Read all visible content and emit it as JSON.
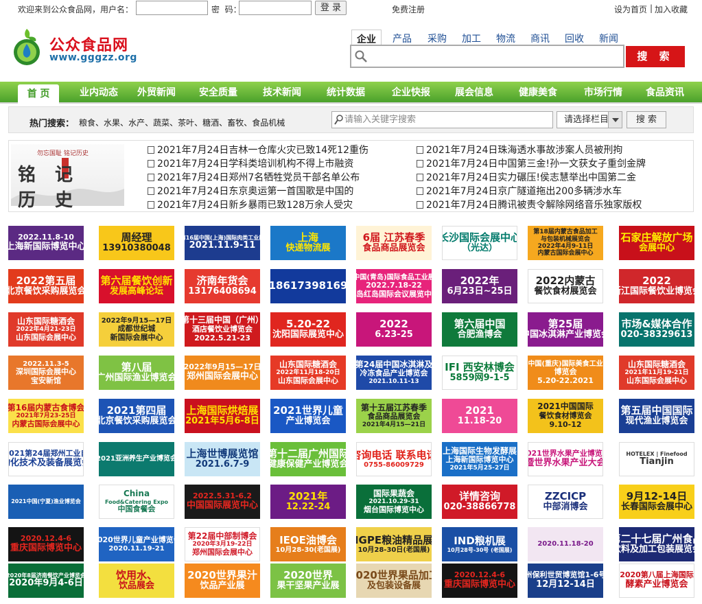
{
  "topbar": {
    "welcome": "欢迎来到公众食品网，用户名：",
    "password_label": "密  码：",
    "login": "登 录",
    "register": "免费注册",
    "set_home": "设为首页",
    "separator": "|",
    "favorite": "加入收藏"
  },
  "logo": {
    "name": "公众食品网",
    "url": "www.gggzz.org"
  },
  "search": {
    "tabs": [
      "企业",
      "产品",
      "采购",
      "加工",
      "物流",
      "商讯",
      "回收",
      "新闻"
    ],
    "active_tab": "企业",
    "button": "搜 索"
  },
  "nav": [
    "首 页",
    "业内动态",
    "外贸新闻",
    "安全质量",
    "技术新闻",
    "统计数据",
    "企业快报",
    "展会信息",
    "健康美食",
    "市场行情",
    "食品资讯"
  ],
  "hot": {
    "label": "热门搜索：",
    "words": [
      "粮食",
      "水果",
      "水产",
      "蔬菜",
      "茶叶",
      "糖酒",
      "畜牧",
      "食品机械"
    ],
    "placeholder": "请输入关键字搜索",
    "select": "请选择栏目",
    "button": "搜 索"
  },
  "news": {
    "image_text": "铭记历史",
    "image_small": "勿忘国耻 铭记历史",
    "left": [
      "2021年7月24日吉林一仓库火灾已致14死12重伤",
      "2021年7月24日学科类培训机构不得上市融资",
      "2021年7月24日郑州7名牺牲党员干部名单公布",
      "2021年7月24日东京奥运第一首国歌是中国的",
      "2021年7月24日新乡暴雨已致128万余人受灾"
    ],
    "right": [
      "2021年7月24日珠海透水事故涉案人员被刑拘",
      "2021年7月24日中国第三金!孙一文获女子重剑金牌",
      "2021年7月24日实力碾压!侯志慧举出中国第二金",
      "2021年7月24日京广隧道拖出200多辆涉水车",
      "2021年7月24日腾讯被责令解除网络音乐独家版权"
    ]
  },
  "ads": [
    [
      {
        "l": [
          "2022.11.8-10",
          "上海新国际博览中心"
        ],
        "bg": "#5b2a83",
        "fg": "#fff"
      },
      {
        "l": [
          "周经理",
          "13910380048"
        ],
        "bg": "#f8c71a",
        "fg": "#222"
      },
      {
        "l": [
          "第16届中国(上海)国际肉类工业展",
          "2021.11.9-11"
        ],
        "bg": "#1d3c8f",
        "fg": "#fff"
      },
      {
        "l": [
          "上海",
          "快递物流展"
        ],
        "bg": "#1b78c8",
        "fg": "#ffe600"
      },
      {
        "l": [
          "6届 江苏春季",
          "食品商品展览会"
        ],
        "bg": "#fff3d6",
        "fg": "#d0181d"
      },
      {
        "l": [
          "长沙国际会展中心",
          "（光达）"
        ],
        "bg": "#fff",
        "fg": "#007a6b"
      },
      {
        "l": [
          "第18届内蒙古食品加工",
          "与包装机械展览会",
          "2022年4月9-11日",
          "内蒙古国际会展中心"
        ],
        "bg": "#f6a81f",
        "fg": "#222"
      },
      {
        "l": [
          "石家庄解放广场",
          "会展中心"
        ],
        "bg": "#c8101a",
        "fg": "#ffee00"
      }
    ],
    [
      {
        "l": [
          "2022第五届",
          "北京餐饮采购展览会"
        ],
        "bg": "#e23b1c",
        "fg": "#fff"
      },
      {
        "l": [
          "第六届餐饮创新",
          "发展高峰论坛"
        ],
        "bg": "#d8102c",
        "fg": "#ffe000"
      },
      {
        "l": [
          "济南年货会",
          "13176408694"
        ],
        "bg": "#e63a2f",
        "fg": "#fff"
      },
      {
        "l": [
          "18617398169"
        ],
        "bg": "#123a9c",
        "fg": "#fff"
      },
      {
        "l": [
          "中国(青岛)国际食品工业展",
          "2022.7.18-22",
          "青岛红岛国际会议展览中心"
        ],
        "bg": "#e7247b",
        "fg": "#fff"
      },
      {
        "l": [
          "2022年",
          "6月23日~25日"
        ],
        "bg": "#6a1f7a",
        "fg": "#fff"
      },
      {
        "l": [
          "2022内蒙古",
          "餐饮食材展览会"
        ],
        "bg": "#fff",
        "fg": "#222"
      },
      {
        "l": [
          "2022",
          "浙江国际餐饮业博览会"
        ],
        "bg": "#d0272b",
        "fg": "#fff"
      }
    ],
    [
      {
        "l": [
          "山东国际糖酒会",
          "2022年4月21-23日",
          "山东国际会展中心"
        ],
        "bg": "#e03a2a",
        "fg": "#fff"
      },
      {
        "l": [
          "2022年9月15—17日",
          "成都世纪城",
          "新国际会展中心"
        ],
        "bg": "#f5cf3b",
        "fg": "#222"
      },
      {
        "l": [
          "第十三届中国（广州）",
          "酒店餐饮业博览会",
          "2022.5.21-23"
        ],
        "bg": "#cf1a1e",
        "fg": "#fff"
      },
      {
        "l": [
          "5.20-22",
          "沈阳国际展览中心"
        ],
        "bg": "#e0261f",
        "fg": "#fff"
      },
      {
        "l": [
          "2022",
          "6.23-25"
        ],
        "bg": "#c8167a",
        "fg": "#fff"
      },
      {
        "l": [
          "第六届中国",
          "合肥渔博会"
        ],
        "bg": "#0f7a3b",
        "fg": "#fff"
      },
      {
        "l": [
          "第25届",
          "中国冰淇淋产业博览会"
        ],
        "bg": "#8a1b8e",
        "fg": "#fff"
      },
      {
        "l": [
          "市场&媒体合作",
          "020-38329613"
        ],
        "bg": "#08746d",
        "fg": "#fff"
      }
    ],
    [
      {
        "l": [
          "2022.11.3-5",
          "深圳国际会展中心",
          "宝安新馆"
        ],
        "bg": "#e8772b",
        "fg": "#fff"
      },
      {
        "l": [
          "第八届",
          "广州国际渔业博览会"
        ],
        "bg": "#7fc244",
        "fg": "#fff"
      },
      {
        "l": [
          "2022年9月15—17日",
          "郑州国际会展中心"
        ],
        "bg": "#f08a1d",
        "fg": "#fff"
      },
      {
        "l": [
          "山东国际糖酒会",
          "2022年11月18-20日",
          "山东国际会展中心"
        ],
        "bg": "#e63a26",
        "fg": "#fff"
      },
      {
        "l": [
          "第24届中国冰淇淋及",
          "冷冻食品产业博览会",
          "2021.10.11-13"
        ],
        "bg": "#1f4aa8",
        "fg": "#fff"
      },
      {
        "l": [
          "IFI 西安林博会",
          "5859网9-1-5"
        ],
        "bg": "#fff",
        "fg": "#0a7a3a"
      },
      {
        "l": [
          "中国(重庆)国际美食工业",
          "博览会",
          "5.20-22.2021"
        ],
        "bg": "#f08c1a",
        "fg": "#fff"
      },
      {
        "l": [
          "山东国际糖酒会",
          "2021年11月19-21日",
          "山东国际会展中心"
        ],
        "bg": "#e03a2a",
        "fg": "#fff"
      }
    ],
    [
      {
        "l": [
          "第16届内蒙古食博会",
          "2021年7月23-25日",
          "内蒙古国际会展中心"
        ],
        "bg": "#fbe04a",
        "fg": "#c8101a"
      },
      {
        "l": [
          "2021第四届",
          "北京餐饮采购展览会"
        ],
        "bg": "#1d54b5",
        "fg": "#fff"
      },
      {
        "l": [
          "上海国际烘焙展",
          "2021年5月6-8日"
        ],
        "bg": "#c9101e",
        "fg": "#ffe000"
      },
      {
        "l": [
          "2021世界儿童",
          "产业博览会"
        ],
        "bg": "#1a58c4",
        "fg": "#fff"
      },
      {
        "l": [
          "第十五届江苏春季",
          "食品商品展览会",
          "2021年4月15—21日"
        ],
        "bg": "#9bd24a",
        "fg": "#222"
      },
      {
        "l": [
          "2021",
          "11.18-20"
        ],
        "bg": "#ef4a96",
        "fg": "#fff"
      },
      {
        "l": [
          "2021中国国际",
          "餐饮食材博览会",
          "9.10-12"
        ],
        "bg": "#f3c21b",
        "fg": "#222"
      },
      {
        "l": [
          "第五届中国国际",
          "现代渔业博览会"
        ],
        "bg": "#1a3f94",
        "fg": "#fff"
      }
    ],
    [
      {
        "l": [
          "2021第24届郑州工业自",
          "动化技术及装备展览会"
        ],
        "bg": "#fff",
        "fg": "#1a3f94"
      },
      {
        "l": [
          "2021亚洲养生产业博览会"
        ],
        "bg": "#0c7a6e",
        "fg": "#fff"
      },
      {
        "l": [
          "上海世博展览馆",
          "2021.6.7-9"
        ],
        "bg": "#c9e6f5",
        "fg": "#123a7a"
      },
      {
        "l": [
          "第十二届广州国际",
          "健康保健产业博览会"
        ],
        "bg": "#6abf3a",
        "fg": "#fff"
      },
      {
        "l": [
          "咨询电话 联系电话",
          "0755-86009729"
        ],
        "bg": "#fff",
        "fg": "#e1231b"
      },
      {
        "l": [
          "上海国际生物发酵展",
          "上海新国际博览中心",
          "2021年5月25-27日"
        ],
        "bg": "#1a6fc7",
        "fg": "#fff"
      },
      {
        "l": [
          "2021世界水果产业博览会",
          "暨世界水果产业大会"
        ],
        "bg": "#fff",
        "fg": "#c8167a"
      },
      {
        "l": [
          "HOTELEX | Finefood",
          "Tianjin"
        ],
        "bg": "#fff",
        "fg": "#333"
      }
    ],
    [
      {
        "l": [
          "2021中国(宁夏)渔业博览会"
        ],
        "bg": "#1a5fb4",
        "fg": "#fff"
      },
      {
        "l": [
          "China",
          "Food&Catering Expo",
          "中国食餐会"
        ],
        "bg": "#fff",
        "fg": "#1a7a55"
      },
      {
        "l": [
          "2022.5.31-6.2",
          "中国国际展览中心"
        ],
        "bg": "#1a1a1a",
        "fg": "#e6261f"
      },
      {
        "l": [
          "2021年",
          "12.22-24"
        ],
        "bg": "#6c1c85",
        "fg": "#ffe000"
      },
      {
        "l": [
          "国际果蔬会",
          "2021.10.29-31",
          "烟台国际博览中心"
        ],
        "bg": "#0a6f3a",
        "fg": "#fff"
      },
      {
        "l": [
          "详情咨询",
          "020-38866778"
        ],
        "bg": "#d01a28",
        "fg": "#fff"
      },
      {
        "l": [
          "ZZCICP",
          "中部消博会"
        ],
        "bg": "#fff",
        "fg": "#1a2f7a"
      },
      {
        "l": [
          "9月12-14日",
          "长春国际会展中心"
        ],
        "bg": "#f8cf1a",
        "fg": "#222"
      }
    ],
    [
      {
        "l": [
          "2020.12.4-6",
          "重庆国际博览中心"
        ],
        "bg": "#141414",
        "fg": "#e6261f"
      },
      {
        "l": [
          "2020世界儿童产业博览会",
          "2020.11.19-21"
        ],
        "bg": "#2064c2",
        "fg": "#fff"
      },
      {
        "l": [
          "第22届中部制博会",
          "2020年3月19-22日",
          "郑州国际会展中心"
        ],
        "bg": "#fff",
        "fg": "#d01a28"
      },
      {
        "l": [
          "IEOE油博会",
          "10月28-30(老国展)"
        ],
        "bg": "#e67e1b",
        "fg": "#fff"
      },
      {
        "l": [
          "IGPE粮油精品展",
          "10月28-30日(老国展)"
        ],
        "bg": "#efd04a",
        "fg": "#222"
      },
      {
        "l": [
          "IND粮机展",
          "10月28号-30号 (老国展)"
        ],
        "bg": "#1a4fa5",
        "fg": "#fff"
      },
      {
        "l": [
          "2020.11.18-20"
        ],
        "bg": "#f2e6f2",
        "fg": "#7a1a8a"
      },
      {
        "l": [
          "第二十七届广州食品",
          "饮料及加工包装展览会"
        ],
        "bg": "#1d2a74",
        "fg": "#fff"
      }
    ],
    [
      {
        "l": [
          "2020年8届济南餐饮产业博览会",
          "2020年9月4-6日"
        ],
        "bg": "#0a6e38",
        "fg": "#fff"
      },
      {
        "l": [
          "饮用水、",
          "饮品展会"
        ],
        "bg": "#f3df3f",
        "fg": "#c8101a"
      },
      {
        "l": [
          "2020世界果汁",
          "饮品产业展"
        ],
        "bg": "#f58a1e",
        "fg": "#fff"
      },
      {
        "l": [
          "2020世界",
          "果干坚果产业展"
        ],
        "bg": "#7cc245",
        "fg": "#fff"
      },
      {
        "l": [
          "2020世界果品加工",
          "及包装设备展"
        ],
        "bg": "#e7d7b2",
        "fg": "#7a4a1a"
      },
      {
        "l": [
          "2020.12.4-6",
          "重庆国际博览中心"
        ],
        "bg": "#141414",
        "fg": "#e6261f"
      },
      {
        "l": [
          "广州保利世贸博览馆1-6号馆",
          "12月12-14日"
        ],
        "bg": "#1a3f8a",
        "fg": "#fff"
      },
      {
        "l": [
          "2020第八届上海国际",
          "酵素产业博览会"
        ],
        "bg": "#fff",
        "fg": "#c8101a"
      }
    ]
  ]
}
